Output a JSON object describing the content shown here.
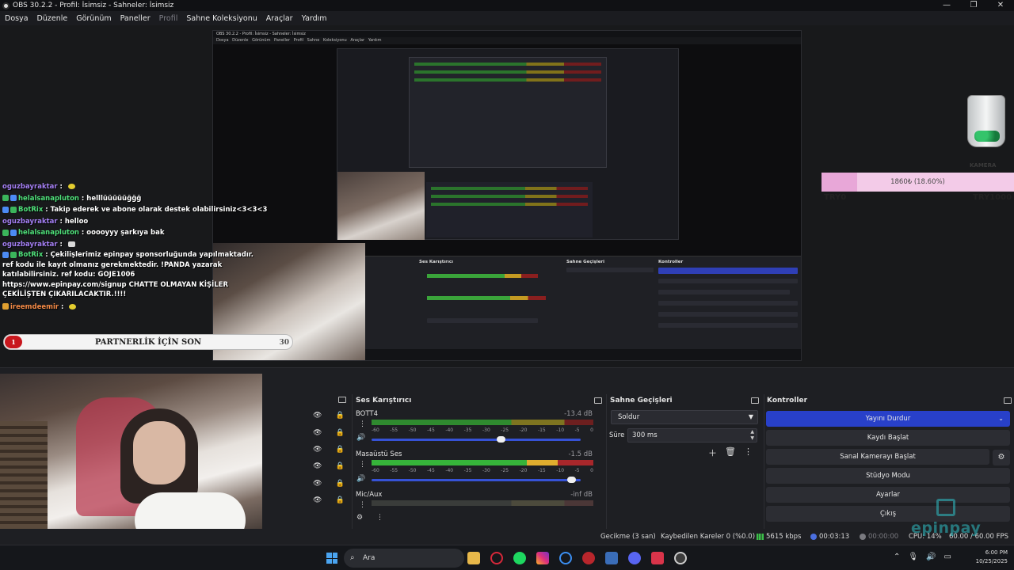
{
  "window": {
    "title": "OBS 30.2.2 - Profil: İsimsiz - Sahneler: İsimsiz",
    "controls": [
      "—",
      "❐",
      "✕"
    ]
  },
  "menu": [
    "Dosya",
    "Düzenle",
    "Görünüm",
    "Paneller",
    "Profil",
    "Sahne Koleksiyonu",
    "Araçlar",
    "Yardım"
  ],
  "nested": {
    "title": "OBS 30.2.2 - Profil: İsimsiz - Sahneler: İsimsiz",
    "menu": "Dosya Düzenle Görünüm Paneller Profil Sahne Koleksiyonu Araçlar Yardım",
    "mixer_title": "Ses Karıştırıcı",
    "trans_title": "Sahne Geçişleri",
    "ctrl_title": "Kontroller"
  },
  "chat": [
    {
      "user": "oguzbayraktar",
      "text": "",
      "color": "#a47ff3",
      "badge": "",
      "emote": true
    },
    {
      "user": "helalsanapluton",
      "text": "helllüüüüüğğğ",
      "color": "#4fe07a",
      "badge": "g",
      "emote": false
    },
    {
      "user": "BotRix",
      "text": "Takip ederek ve abone olarak destek olabilirsiniz<3<3<3",
      "color": "#4fe07a",
      "badge": "b",
      "emote": false
    },
    {
      "user": "oguzbayraktar",
      "text": "helloo",
      "color": "#a47ff3",
      "badge": "",
      "emote": false
    },
    {
      "user": "helalsanapluton",
      "text": "ooooyyy şarkıya bak",
      "color": "#4fe07a",
      "badge": "g",
      "emote": false
    },
    {
      "user": "oguzbayraktar",
      "text": "",
      "color": "#a47ff3",
      "badge": "",
      "emote": true
    }
  ],
  "chat_long": {
    "user": "BotRix",
    "text": "Çekilişlerimiz epinpay sponsorluğunda yapılmaktadır. ref kodu ile kayıt olmanız gerekmektedir. !PANDA yazarak katılabilirsiniz. ref kodu: GOJE1006 https://www.epinpay.com/signup CHATTE OLMAYAN KİŞİLER ÇEKİLİŞTEN ÇIKARILACAKTIR.!!!!"
  },
  "chat_last": {
    "user": "ireemdeemir",
    "text": ""
  },
  "partner": {
    "left": "1",
    "label": "PARTNERLİK İÇİN SON",
    "right": "30"
  },
  "goal": {
    "label": "1860₺ (18.60%)",
    "progress_percent": 18.6,
    "min": "TRY0",
    "max": "TRY1000",
    "overlay": "KAMERA"
  },
  "mixer": {
    "title": "Ses Karıştırıcı",
    "scale": [
      "-60",
      "-55",
      "-50",
      "-45",
      "-40",
      "-35",
      "-30",
      "-25",
      "-20",
      "-15",
      "-10",
      "-5",
      "0"
    ],
    "channels": [
      {
        "name": "BOTT4",
        "db": "-13.4 dB",
        "volume_percent": 62
      },
      {
        "name": "Masaüstü Ses",
        "db": "-1.5 dB",
        "volume_percent": 96
      },
      {
        "name": "Mic/Aux",
        "db": "-inf dB",
        "volume_percent": 0
      }
    ]
  },
  "transitions": {
    "title": "Sahne Geçişleri",
    "selected": "Soldur",
    "duration_label": "Süre",
    "duration_value": "300 ms"
  },
  "controls": {
    "title": "Kontroller",
    "stop_stream": "Yayını Durdur",
    "start_record": "Kaydı Başlat",
    "virtual_cam": "Sanal Kamerayı Başlat",
    "studio_mode": "Stüdyo Modu",
    "settings": "Ayarlar",
    "exit": "Çıkış"
  },
  "status": {
    "delay": "Gecikme (3 san)",
    "dropped": "Kaybedilen Kareler 0 (%0.0)",
    "bitrate": "5615 kbps",
    "stream_time": "00:03:13",
    "rec_time": "00:00:00",
    "cpu": "CPU: 14%",
    "fps": "60.00 / 60.00 FPS"
  },
  "watermark": "epinpay",
  "taskbar": {
    "search": "Ara",
    "time": "6:00 PM",
    "date": "10/25/2025"
  },
  "colors": {
    "accent": "#2840c9",
    "meter_green": "#36b43a",
    "meter_yellow": "#e0ad2e",
    "meter_red": "#a8272b"
  }
}
